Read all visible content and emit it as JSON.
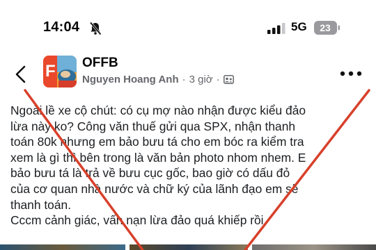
{
  "status_bar": {
    "time": "14:04",
    "network": "5G",
    "battery": "23",
    "icons": [
      "bell-slash-icon",
      "signal-icon",
      "battery-icon"
    ]
  },
  "header": {
    "group_name": "OFFB",
    "author": "Nguyen Hoang Anh",
    "separator": "·",
    "time_ago": "3 giờ",
    "separator2": "·",
    "icons": [
      "back-chevron-icon",
      "group-privacy-icon",
      "more-options-icon"
    ]
  },
  "post": {
    "lines": [
      "Ngoài lề xe cộ chút: có cụ mợ nào nhận được kiểu đảo",
      "lừa này ko? Công văn thuế gửi qua SPX, nhận thanh",
      "toán 80k nhưng em bảo bưu tá cho em bóc ra kiểm tra",
      "xem là gì thì bên trong là văn bản photo nhom nhem. E",
      "bảo bưu tá là trả về bưu cục gốc, bao giờ có dấu đỏ",
      "của cơ quan nhà nước và chữ ký của lãnh đạo em sẽ",
      "thanh toán.",
      "Cccm cảnh giác, vấn nạn lừa đảo quá khiếp rồi."
    ]
  },
  "colors": {
    "cross": "#d8402a",
    "meta": "#65676b",
    "text": "#1c1e21"
  }
}
